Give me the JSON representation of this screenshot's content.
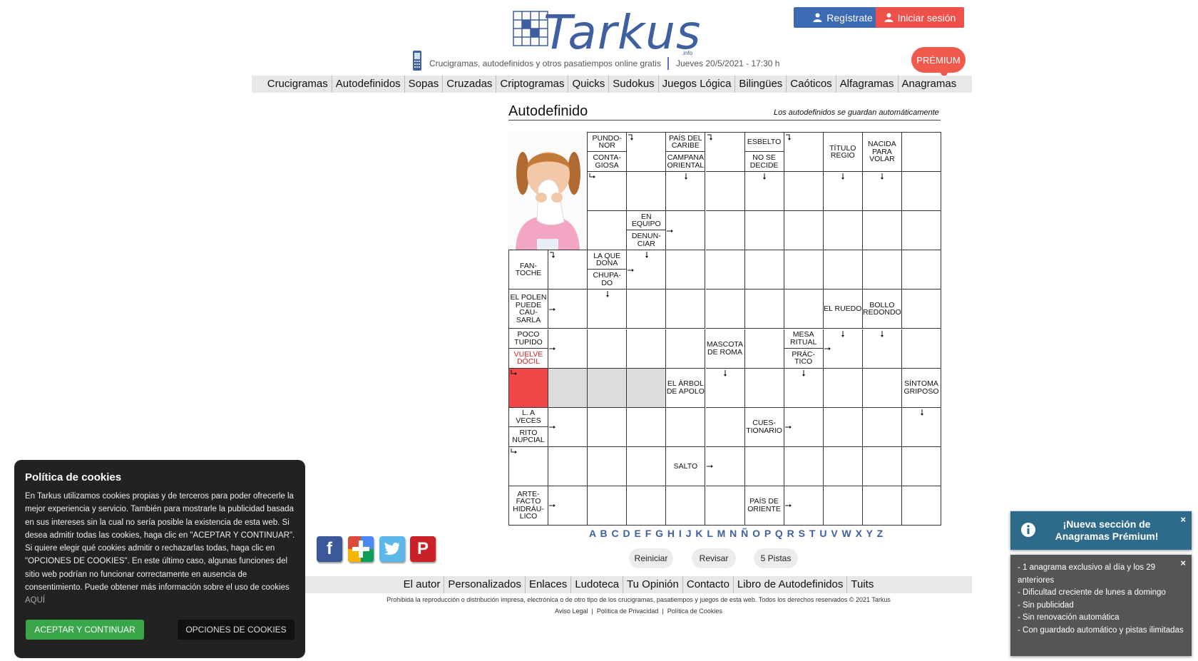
{
  "header": {
    "logo_text": "Tarkus",
    "logo_suffix": ".info",
    "tagline": "Crucigramas, autodefinidos y otros pasatiempos online gratis",
    "date": "Jueves 20/5/2021 - 17:30 h",
    "register_label": "Regístrate",
    "login_label": "Iniciar sesión",
    "premium_label": "PRÉMIUM"
  },
  "nav": [
    "Crucigramas",
    "Autodefinidos",
    "Sopas",
    "Cruzadas",
    "Criptogramas",
    "Quicks",
    "Sudokus",
    "Juegos Lógica",
    "Bilingües",
    "Caóticos",
    "Alfagramas",
    "Anagramas"
  ],
  "puzzle": {
    "title": "Autodefinido",
    "saved_note": "Los autodefinidos se guardan automáticamente",
    "clues": [
      {
        "id": "pundonor",
        "text": "PUNDO-NOR"
      },
      {
        "id": "contagiosa",
        "text": "CONTA-GIOSA"
      },
      {
        "id": "pais-caribe",
        "text": "PAÍS DEL CARIBE"
      },
      {
        "id": "campana",
        "text": "CAMPANA ORIENTAL"
      },
      {
        "id": "esbelto",
        "text": "ESBELTO"
      },
      {
        "id": "no-se-decide",
        "text": "NO SE DECIDE"
      },
      {
        "id": "titulo-regio",
        "text": "TÍTULO REGIO"
      },
      {
        "id": "nacida",
        "text": "NACIDA PARA VOLAR"
      },
      {
        "id": "en-equipo",
        "text": "EN EQUIPO"
      },
      {
        "id": "denunciar",
        "text": "DENUN-CIAR"
      },
      {
        "id": "fantoche",
        "text": "FAN-TOCHE"
      },
      {
        "id": "la-que-dona",
        "text": "LA QUE DONA"
      },
      {
        "id": "chupado",
        "text": "CHUPA-DO"
      },
      {
        "id": "polen",
        "text": "EL POLEN PUEDE CAU-SARLA"
      },
      {
        "id": "el-ruedo",
        "text": "EL RUEDO"
      },
      {
        "id": "bollo",
        "text": "BOLLO REDONDO"
      },
      {
        "id": "poco-tupido",
        "text": "POCO TUPIDO"
      },
      {
        "id": "vuelve-docil",
        "text": "VUELVE DÓCIL"
      },
      {
        "id": "mascota",
        "text": "MASCOTA DE ROMA"
      },
      {
        "id": "mesa-ritual",
        "text": "MESA RITUAL"
      },
      {
        "id": "practico",
        "text": "PRÁC-TICO"
      },
      {
        "id": "arbol-apolo",
        "text": "EL ÁRBOL DE APOLO"
      },
      {
        "id": "sintoma",
        "text": "SÍNTOMA GRIPOSO"
      },
      {
        "id": "a-veces",
        "text": "L. A VECES"
      },
      {
        "id": "rito",
        "text": "RITO NUPCIAL"
      },
      {
        "id": "cuestionario",
        "text": "CUES-TIONARIO"
      },
      {
        "id": "salto",
        "text": "SALTO"
      },
      {
        "id": "artefacto",
        "text": "ARTE-FACTO HIDRÁU-LICO"
      },
      {
        "id": "pais-oriente",
        "text": "PAÍS DE ORIENTE"
      }
    ],
    "alphabet": "A B C D E F G H I J K L M N Ñ O P Q R S T U V W X Y Z",
    "reset_label": "Reiniciar",
    "check_label": "Revisar",
    "hints_label": "5 Pistas"
  },
  "social": {
    "facebook": "f",
    "plus": "+",
    "pinterest": "P"
  },
  "footer": {
    "links": [
      "El autor",
      "Personalizados",
      "Enlaces",
      "Ludoteca",
      "Tu Opinión",
      "Contacto",
      "Libro de Autodefinidos",
      "Tuits"
    ],
    "copyright": "Prohibida la reproducción o distribución impresa, electrónica o de otro tipo de los crucigramas, pasatiempos y juegos de esta web. Todos los derechos reservados © 2021 Tarkus",
    "legal": [
      "Aviso Legal",
      "Política de Privacidad",
      "Política de Cookies"
    ]
  },
  "cookie": {
    "title": "Política de cookies",
    "body": "En Tarkus utilizamos cookies propias y de terceros para poder ofrecerle la mejor experiencia y servicio. También para mostrarle la publicidad basada en sus intereses sin la cual no sería posible la existencia de esta web. Si desea admitir todas las cookies, haga clic en \"ACEPTAR Y CONTINUAR\". Si quiere elegir qué cookies admitir o rechazarlas todas, haga clic en \"OPCIONES DE COOKIES\". En este último caso, algunas funciones del sitio web podrían no funcionar correctamente en ausencia de consentimiento. Puede obtener más información sobre el uso de cookies",
    "link": "AQUÍ",
    "accept_label": "ACEPTAR Y CONTINUAR",
    "options_label": "OPCIONES DE COOKIES"
  },
  "notifications": {
    "title": "¡Nueva sección de Anagramas Prémium!",
    "close": "×",
    "items": [
      "- 1 anagrama exclusivo al día y los 29 anteriores",
      "- Dificultad creciente de lunes a domingo",
      "- Sin publicidad",
      "- Sin renovación automática",
      "- Con guardado automático y pistas ilimitadas"
    ]
  },
  "colors": {
    "brand": "#3e5fa0",
    "register": "#3d6bb3",
    "login": "#f0504a",
    "premium": "#ef5a4c",
    "selected": "#f04848",
    "accept": "#3aa64a"
  }
}
